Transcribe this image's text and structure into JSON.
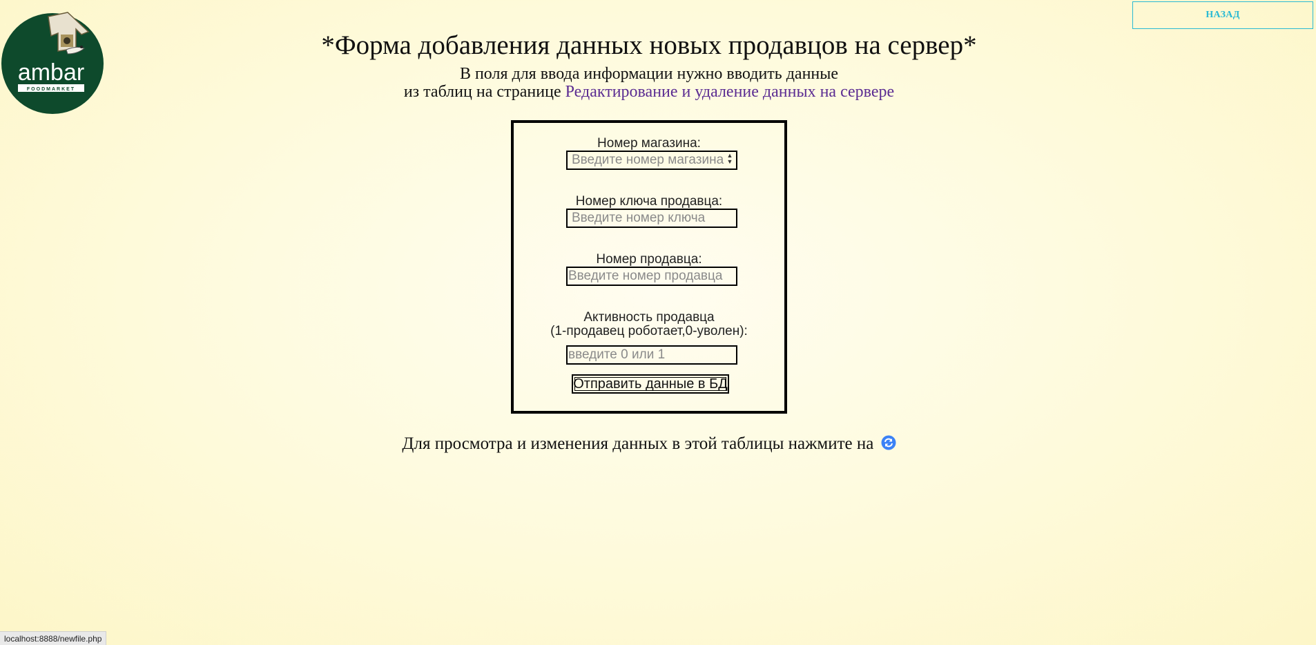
{
  "logo": {
    "text": "ambar",
    "subtext": "FOODMARKET",
    "icon": "birdhouse-icon"
  },
  "header": {
    "back_label": "НАЗАД",
    "title": "*Форма добавления данных новых продавцов на сервер*",
    "subtitle_line1": "В поля для ввода информации нужно вводить данные",
    "subtitle_line2_prefix": "из таблиц на странице ",
    "subtitle_link": "Редактирование и удаление данных на сервере"
  },
  "form": {
    "fields": [
      {
        "label": "Номер магазина:",
        "placeholder": "Введите номер магазина"
      },
      {
        "label": "Номер ключа продавца:",
        "placeholder": "Введите номер ключа"
      },
      {
        "label": "Номер продавца:",
        "placeholder": "Введите номер продавца"
      },
      {
        "label_line1": "Активность продавца",
        "label_line2": "(1-продавец роботает,0-уволен):",
        "placeholder": "введите 0 или 1"
      }
    ],
    "submit_label": "Отправить данные в БД"
  },
  "footer": {
    "hint": "Для просмотра и изменения данных в этой таблицы нажмите на",
    "icon": "refresh-icon"
  },
  "status_bar": {
    "url": "localhost:8888/newfile.php"
  },
  "colors": {
    "accent": "#27b9d4",
    "link": "#5b2c92",
    "logo_green": "#0e4a2c",
    "icon_blue": "#3b82f6"
  }
}
